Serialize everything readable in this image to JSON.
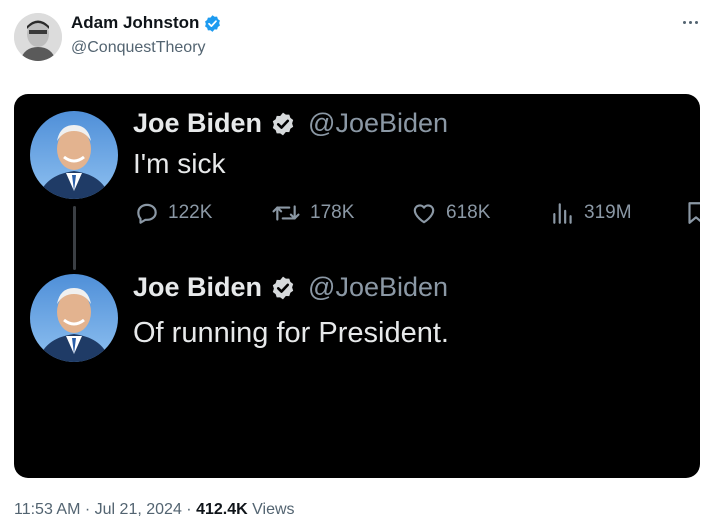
{
  "author": {
    "name": "Adam Johnston",
    "handle": "@ConquestTheory",
    "verified": true,
    "avatar_icon": "person-avatar-icon"
  },
  "more_icon": "more-horizontal-icon",
  "embedded_screenshot": {
    "posts": [
      {
        "name": "Joe Biden",
        "handle": "@JoeBiden",
        "text": "I'm sick",
        "verified": true,
        "actions": {
          "replies": "122K",
          "reposts": "178K",
          "likes": "618K",
          "views": "319M"
        }
      },
      {
        "name": "Joe Biden",
        "handle": "@JoeBiden",
        "text": "Of running for President.",
        "verified": true
      }
    ]
  },
  "footer": {
    "time": "11:53 AM",
    "separator": "·",
    "date": "Jul 21, 2024",
    "views_count": "412.4K",
    "views_label": "Views"
  },
  "colors": {
    "verified_blue": "#1d9bf0",
    "dark_bg": "#000000",
    "muted_dark": "#8b98a5",
    "muted_light": "#536471"
  }
}
